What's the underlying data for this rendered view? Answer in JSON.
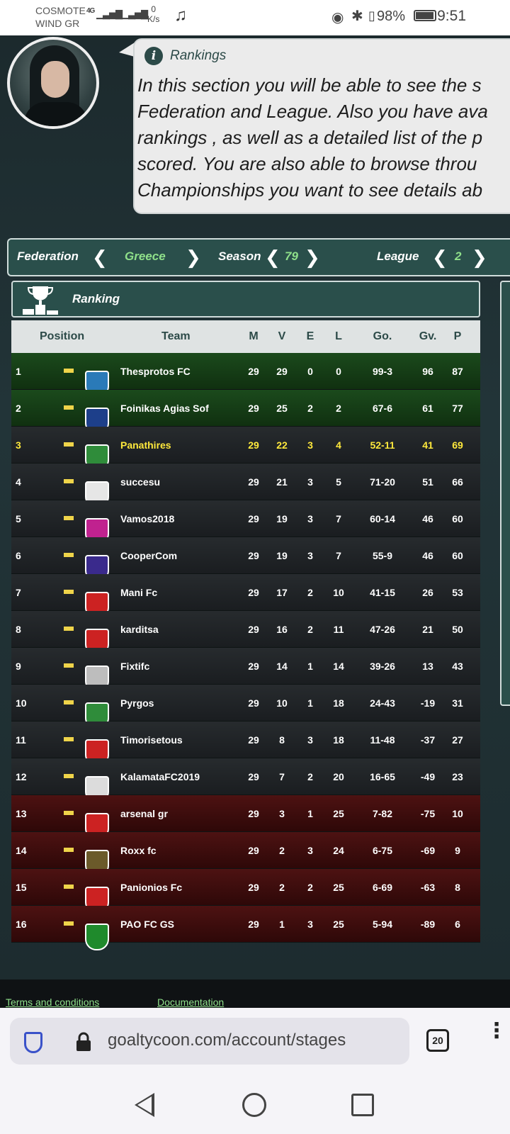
{
  "status_bar": {
    "carrier_1": "COSMOTE",
    "carrier_2": "WIND GR",
    "network": "4G",
    "speed_value": "0",
    "speed_unit": "K/s",
    "battery": "98%",
    "time": "9:51"
  },
  "info": {
    "title": "Rankings",
    "lines": [
      "In this section you will be able to see the s",
      "Federation and League. Also you have ava",
      "rankings , as well as a detailed list of the p",
      "scored. You are also able to browse throu",
      "Championships you want to see details ab"
    ]
  },
  "selector": {
    "federation_label": "Federation",
    "federation_value": "Greece",
    "season_label": "Season",
    "season_value": "79",
    "league_label": "League",
    "league_value": "2"
  },
  "ranking": {
    "title": "Ranking",
    "headers": {
      "position": "Position",
      "team": "Team",
      "m": "M",
      "v": "V",
      "e": "E",
      "l": "L",
      "go": "Go.",
      "gv": "Gv.",
      "p": "P"
    },
    "rows": [
      {
        "pos": "1",
        "team": "Thesprotos FC",
        "m": "29",
        "v": "29",
        "e": "0",
        "l": "0",
        "go": "99-3",
        "gv": "96",
        "p": "87",
        "zone": "promo",
        "crest": "#2a7ab8"
      },
      {
        "pos": "2",
        "team": "Foinikas Agias Sof",
        "m": "29",
        "v": "25",
        "e": "2",
        "l": "2",
        "go": "67-6",
        "gv": "61",
        "p": "77",
        "zone": "promo",
        "crest": "#1d3f8a"
      },
      {
        "pos": "3",
        "team": "Panathires",
        "m": "29",
        "v": "22",
        "e": "3",
        "l": "4",
        "go": "52-11",
        "gv": "41",
        "p": "69",
        "zone": "mid",
        "own": true,
        "crest": "#2f8c3a"
      },
      {
        "pos": "4",
        "team": "succesu",
        "m": "29",
        "v": "21",
        "e": "3",
        "l": "5",
        "go": "71-20",
        "gv": "51",
        "p": "66",
        "zone": "mid",
        "crest": "#e6e6e6"
      },
      {
        "pos": "5",
        "team": "Vamos2018",
        "m": "29",
        "v": "19",
        "e": "3",
        "l": "7",
        "go": "60-14",
        "gv": "46",
        "p": "60",
        "zone": "mid",
        "crest": "#c0228f"
      },
      {
        "pos": "6",
        "team": "CooperCom",
        "m": "29",
        "v": "19",
        "e": "3",
        "l": "7",
        "go": "55-9",
        "gv": "46",
        "p": "60",
        "zone": "mid",
        "crest": "#3a2a8c"
      },
      {
        "pos": "7",
        "team": "Mani Fc",
        "m": "29",
        "v": "17",
        "e": "2",
        "l": "10",
        "go": "41-15",
        "gv": "26",
        "p": "53",
        "zone": "mid",
        "crest": "#cc2222"
      },
      {
        "pos": "8",
        "team": "karditsa",
        "m": "29",
        "v": "16",
        "e": "2",
        "l": "11",
        "go": "47-26",
        "gv": "21",
        "p": "50",
        "zone": "mid",
        "crest": "#cc2222"
      },
      {
        "pos": "9",
        "team": "Fixtifc",
        "m": "29",
        "v": "14",
        "e": "1",
        "l": "14",
        "go": "39-26",
        "gv": "13",
        "p": "43",
        "zone": "mid",
        "crest": "#bdbdbd"
      },
      {
        "pos": "10",
        "team": "Pyrgos",
        "m": "29",
        "v": "10",
        "e": "1",
        "l": "18",
        "go": "24-43",
        "gv": "-19",
        "p": "31",
        "zone": "mid",
        "crest": "#2f8c3a"
      },
      {
        "pos": "11",
        "team": "Timorisetous",
        "m": "29",
        "v": "8",
        "e": "3",
        "l": "18",
        "go": "11-48",
        "gv": "-37",
        "p": "27",
        "zone": "mid",
        "crest": "#cc2222"
      },
      {
        "pos": "12",
        "team": "KalamataFC2019",
        "m": "29",
        "v": "7",
        "e": "2",
        "l": "20",
        "go": "16-65",
        "gv": "-49",
        "p": "23",
        "zone": "mid",
        "crest": "#dcdcdc"
      },
      {
        "pos": "13",
        "team": "arsenal gr",
        "m": "29",
        "v": "3",
        "e": "1",
        "l": "25",
        "go": "7-82",
        "gv": "-75",
        "p": "10",
        "zone": "releg",
        "crest": "#cc2222"
      },
      {
        "pos": "14",
        "team": "Roxx fc",
        "m": "29",
        "v": "2",
        "e": "3",
        "l": "24",
        "go": "6-75",
        "gv": "-69",
        "p": "9",
        "zone": "releg",
        "crest": "#6b5a2a"
      },
      {
        "pos": "15",
        "team": "Panionios Fc",
        "m": "29",
        "v": "2",
        "e": "2",
        "l": "25",
        "go": "6-69",
        "gv": "-63",
        "p": "8",
        "zone": "releg",
        "crest": "#cc2222"
      },
      {
        "pos": "16",
        "team": "PAO FC GS",
        "m": "29",
        "v": "1",
        "e": "3",
        "l": "25",
        "go": "5-94",
        "gv": "-89",
        "p": "6",
        "zone": "releg",
        "crest": "#1f8a2c"
      }
    ]
  },
  "footer": {
    "terms": "Terms and conditions",
    "docs": "Documentation"
  },
  "browser": {
    "url": "goaltycoon.com/account/stages",
    "tab_count": "20"
  }
}
